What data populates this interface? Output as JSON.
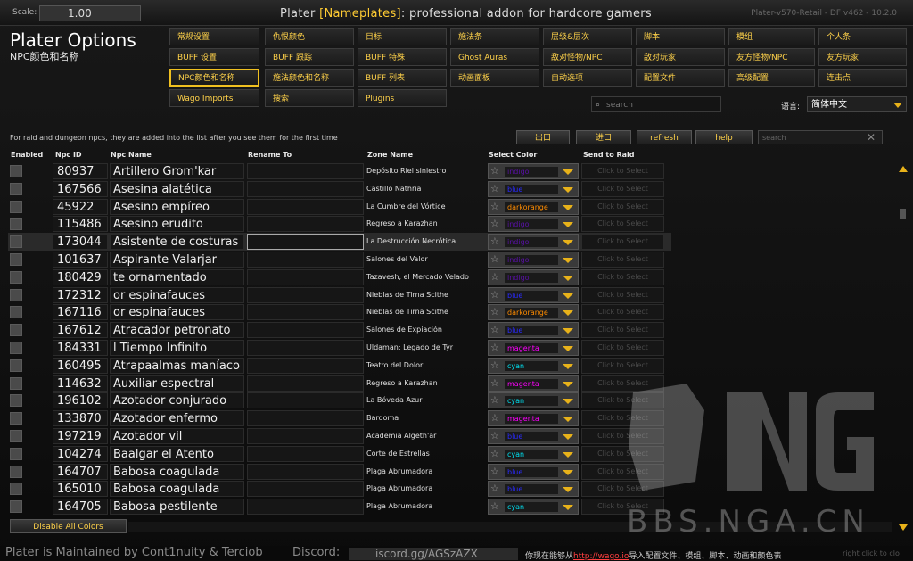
{
  "topbar": {
    "scale_label": "Scale:",
    "scale_value": "1.00",
    "title_pre": "Plater ",
    "title_bracket": "[Nameplates]",
    "title_post": ": professional addon for hardcore gamers",
    "version": "Plater-v570-Retail - DF v462 - 10.2.0"
  },
  "header": {
    "title": "Plater Options",
    "subtitle": "NPC颜色和名称"
  },
  "tabs": [
    [
      "常规设置",
      "仇恨颜色",
      "目标",
      "施法条",
      "层级&层次",
      "脚本",
      "模组",
      "个人条"
    ],
    [
      "BUFF 设置",
      "BUFF 跟踪",
      "BUFF 特殊",
      "Ghost Auras",
      "敌对怪物/NPC",
      "敌对玩家",
      "友方怪物/NPC",
      "友方玩家"
    ],
    [
      "NPC颜色和名称",
      "施法颜色和名称",
      "BUFF 列表",
      "动画面板",
      "自动选项",
      "配置文件",
      "高级配置",
      "连击点"
    ],
    [
      "Wago Imports",
      "搜索",
      "Plugins"
    ]
  ],
  "search_main": {
    "placeholder": "search"
  },
  "language": {
    "label": "语言:",
    "value": "简体中文"
  },
  "list": {
    "description": "For raid and dungeon npcs, they are added into the list after you see them for the first time",
    "export_label": "出口",
    "import_label": "进口",
    "refresh_label": "refresh",
    "help_label": "help",
    "search_placeholder": "search",
    "columns": [
      "Enabled",
      "Npc ID",
      "Npc Name",
      "Rename To",
      "Zone Name",
      "Select Color",
      "Send to Raid"
    ],
    "click_label": "Click to Select",
    "rows": [
      {
        "id": "80937",
        "name": "Artillero Grom'kar",
        "zone": "Depósito Riel siniestro",
        "color": "indigo"
      },
      {
        "id": "167566",
        "name": "Asesina alatética",
        "zone": "Castillo Nathria",
        "color": "blue"
      },
      {
        "id": "45922",
        "name": "Asesino empíreo",
        "zone": "La Cumbre del Vórtice",
        "color": "darkorange"
      },
      {
        "id": "115486",
        "name": "Asesino erudito",
        "zone": "Regreso a Karazhan",
        "color": "indigo"
      },
      {
        "id": "173044",
        "name": "Asistente de costuras",
        "zone": "La Destrucción Necrótica",
        "color": "indigo"
      },
      {
        "id": "101637",
        "name": "Aspirante Valarjar",
        "zone": "Salones del Valor",
        "color": "indigo"
      },
      {
        "id": "180429",
        "name": "te ornamentado",
        "zone": "Tazavesh, el Mercado Velado",
        "color": "indigo"
      },
      {
        "id": "172312",
        "name": "or espinafauces",
        "zone": "Nieblas de Tirna Scithe",
        "color": "blue"
      },
      {
        "id": "167116",
        "name": "or espinafauces",
        "zone": "Nieblas de Tirna Scithe",
        "color": "darkorange"
      },
      {
        "id": "167612",
        "name": "Atracador petronato",
        "zone": "Salones de Expiación",
        "color": "blue"
      },
      {
        "id": "184331",
        "name": "l Tiempo Infinito",
        "zone": "Uldaman: Legado de Tyr",
        "color": "magenta"
      },
      {
        "id": "160495",
        "name": "Atrapaalmas maníaco",
        "zone": "Teatro del Dolor",
        "color": "cyan"
      },
      {
        "id": "114632",
        "name": "Auxiliar espectral",
        "zone": "Regreso a Karazhan",
        "color": "magenta"
      },
      {
        "id": "196102",
        "name": "Azotador conjurado",
        "zone": "La Bóveda Azur",
        "color": "cyan"
      },
      {
        "id": "133870",
        "name": "Azotador enfermo",
        "zone": "Bardoma",
        "color": "magenta"
      },
      {
        "id": "197219",
        "name": "Azotador vil",
        "zone": "Academia Algeth'ar",
        "color": "blue"
      },
      {
        "id": "104274",
        "name": "Baalgar el Atento",
        "zone": "Corte de Estrellas",
        "color": "cyan"
      },
      {
        "id": "164707",
        "name": "Babosa coagulada",
        "zone": "Plaga Abrumadora",
        "color": "blue"
      },
      {
        "id": "165010",
        "name": "Babosa coagulada",
        "zone": "Plaga Abrumadora",
        "color": "blue"
      },
      {
        "id": "164705",
        "name": "Babosa pestilente",
        "zone": "Plaga Abrumadora",
        "color": "cyan"
      }
    ],
    "disable_all_label": "Disable All Colors"
  },
  "color_map": {
    "indigo": "#5a10a8",
    "blue": "#2a2aff",
    "darkorange": "#ff8c00",
    "magenta": "#ff00ff",
    "cyan": "#00e0f0"
  },
  "footer": {
    "maintained": "Plater is Maintained by Cont1nuity & Terciob",
    "discord_label": "Discord:",
    "discord_link": "iscord.gg/AGSzAZX",
    "info_pre": "你现在能够从",
    "info_link": "http://wago.io",
    "info_post": "导入配置文件、模组、脚本、动画和颜色表",
    "right": "right click to clo"
  },
  "watermark": {
    "text": "BBS.NGA.CN"
  }
}
